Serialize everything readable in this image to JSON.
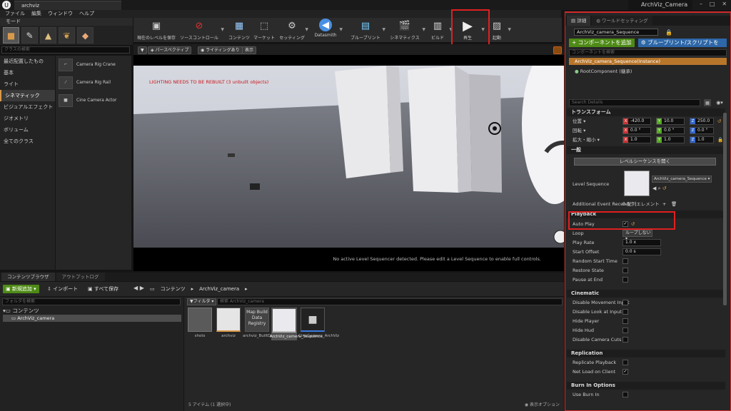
{
  "titlebar": {
    "doc_tab": "archviz",
    "project": "ArchViz_Camera",
    "minimize": "–",
    "maximize": "□",
    "close": "✕"
  },
  "menu": [
    "ファイル",
    "編集",
    "ウィンドウ",
    "ヘルプ"
  ],
  "modes": {
    "tab_label": "モード",
    "search_placeholder": "クラスの検索",
    "categories": [
      "最近配置したもの",
      "基本",
      "ライト",
      "シネマティック",
      "ビジュアルエフェクト",
      "ジオメトリ",
      "ボリューム",
      "全てのクラス"
    ],
    "selected_category": "シネマティック",
    "placeables": [
      "Camera Rig Crane",
      "Camera Rig Rail",
      "Cine Camera Actor"
    ]
  },
  "toolbar": {
    "save_level": "現在のレベルを保存",
    "source_control": "ソースコントロール",
    "content": "コンテンツ",
    "marketplace": "マーケット",
    "settings": "セッティング",
    "datasmith": "Datasmith",
    "blueprint": "ブループリント",
    "cinematics": "シネマティクス",
    "build": "ビルド",
    "play": "再生",
    "launch": "起動"
  },
  "viewport": {
    "perspective": "パースペクティブ",
    "lighting": "ライティングあり",
    "show": "表示",
    "warning": "LIGHTING NEEDS TO BE REBUILT (3 unbuilt objects)",
    "status": "No active Level Sequencer detected. Please edit a Level Sequence to enable full controls."
  },
  "content_browser": {
    "tabs": [
      "コンテンツブラウザ",
      "アウトプットログ"
    ],
    "add_new": "新規追加",
    "import": "インポート",
    "save_all": "すべて保存",
    "path": [
      "コンテンツ",
      "ArchViz_camera"
    ],
    "folder_search": "フォルダを検索",
    "tree_root": "コンテンツ",
    "tree_child": "ArchViz_camera",
    "filters": "フィルタ",
    "asset_search": "検索 ArchViz_camera",
    "map_build_thumb": "Map Build Data Registry",
    "assets": [
      "shots",
      "archviz",
      "archviz_BuiltData",
      "ArchViz_camera_Sequence",
      "CineCamera_ArchViz"
    ],
    "count": "5 アイテム (1 選択中)",
    "view_options": "表示オプション"
  },
  "details": {
    "tabs": [
      "詳細",
      "ワールドセッティング"
    ],
    "actor_name": "ArchViz_camera_Sequence",
    "add_component": "コンポーネントを追加",
    "blueprint_script": "ブループリント/スクリプトを",
    "component_search": "コンポーネントを検索",
    "root_instance": "ArchViz_camera_Sequence(Instance)",
    "root_component": "RootComponent (継承)",
    "details_search": "Search Details",
    "transform": {
      "header": "トランスフォーム",
      "location_label": "位置",
      "location": [
        "-420.0",
        "10.0",
        "250.0"
      ],
      "rotation_label": "回転",
      "rotation": [
        "0.0 °",
        "0.0 °",
        "0.0 °"
      ],
      "scale_label": "拡大・縮小",
      "scale": [
        "1.0",
        "1.0",
        "1.0"
      ]
    },
    "general": {
      "header": "一般",
      "open_sequence": "レベルシーケンスを開く",
      "level_sequence_label": "Level Sequence",
      "level_sequence_value": "ArchViz_camera_Sequence",
      "event_receivers_label": "Additional Event Receive",
      "event_receivers_value": "0 配列エレメント"
    },
    "playback": {
      "header": "Playback",
      "auto_play": "Auto Play",
      "loop": "Loop",
      "loop_value": "ループしない",
      "play_rate": "Play Rate",
      "play_rate_value": "1.0 x",
      "start_offset": "Start Offset",
      "start_offset_value": "0.0 s",
      "random_start": "Random Start Time",
      "restore_state": "Restore State",
      "pause_at_end": "Pause at End"
    },
    "cinematic": {
      "header": "Cinematic",
      "rows": [
        "Disable Movement Input",
        "Disable Look at Input",
        "Hide Player",
        "Hide Hud",
        "Disable Camera Cuts"
      ]
    },
    "replication": {
      "header": "Replication",
      "rows": [
        "Replicate Playback",
        "Net Load on Client"
      ]
    },
    "burn_in": {
      "header": "Burn In Options",
      "rows": [
        "Use Burn In"
      ]
    }
  },
  "colors": {
    "accent_red": "#e02020",
    "add_green": "#4e8a16",
    "bp_blue": "#2d67a8",
    "selection_orange": "#b8762b"
  }
}
